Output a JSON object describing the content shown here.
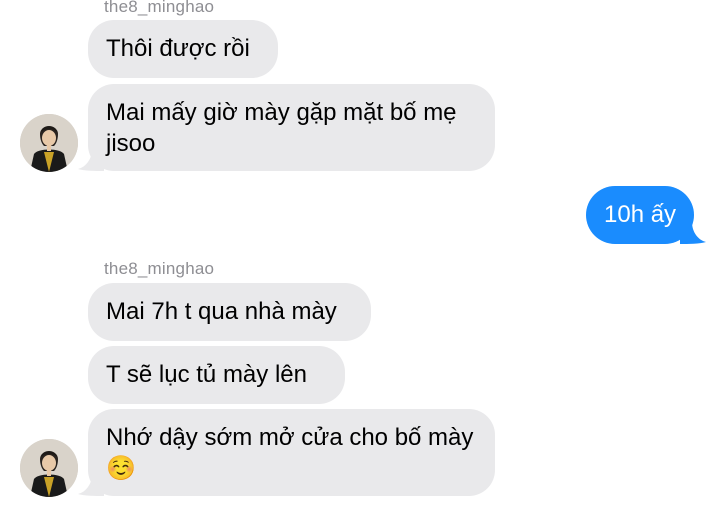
{
  "messages": [
    {
      "sender": "the8_minghao"
    },
    {
      "text": "Thôi được rồi"
    },
    {
      "text": "Mai mấy giờ mày gặp mặt bố mẹ jisoo"
    },
    {
      "text": "10h ấy"
    },
    {
      "sender": "the8_minghao"
    },
    {
      "text": "Mai 7h t qua nhà mày"
    },
    {
      "text": "T sẽ lục tủ mày lên"
    },
    {
      "text": "Nhớ dậy sớm mở cửa cho bố mày",
      "emoji": "☺️"
    }
  ],
  "colors": {
    "incoming_bubble": "#e9e9eb",
    "outgoing_bubble": "#1a8cfe",
    "sender_label": "#8e8e93"
  },
  "icons": [
    "avatar-photo",
    "smiling-face-emoji"
  ]
}
